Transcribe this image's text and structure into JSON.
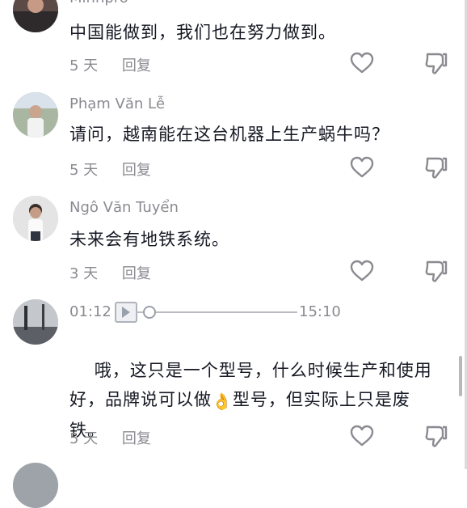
{
  "comments": [
    {
      "username": "Minhpro",
      "text": "中国能做到，我们也在努力做到。",
      "time": "5 天",
      "reply_label": "回复"
    },
    {
      "username": "Phạm Văn Lễ",
      "text": "请问，越南能在这台机器上生产蜗牛吗？",
      "time": "5 天",
      "reply_label": "回复"
    },
    {
      "username": "Ngô Văn Tuyển",
      "text": "未来会有地铁系统。",
      "time": "3 天",
      "reply_label": "回复"
    },
    {
      "audio": {
        "current": "01:12",
        "total": "15:10",
        "progress": 0.08
      },
      "text_before_emoji": "哦，这只是一个型号，什么时候生产和使用好，品牌说可以做",
      "emoji": "👌",
      "text_after_emoji": "型号，但实际上只是废铁。",
      "time": "5 天",
      "reply_label": "回复"
    }
  ],
  "icons": {
    "like": "heart-outline-icon",
    "dislike": "thumbs-down-outline-icon",
    "play": "play-icon"
  },
  "colors": {
    "text": "#161823",
    "secondary": "#8a8b91",
    "background": "#ffffff"
  }
}
